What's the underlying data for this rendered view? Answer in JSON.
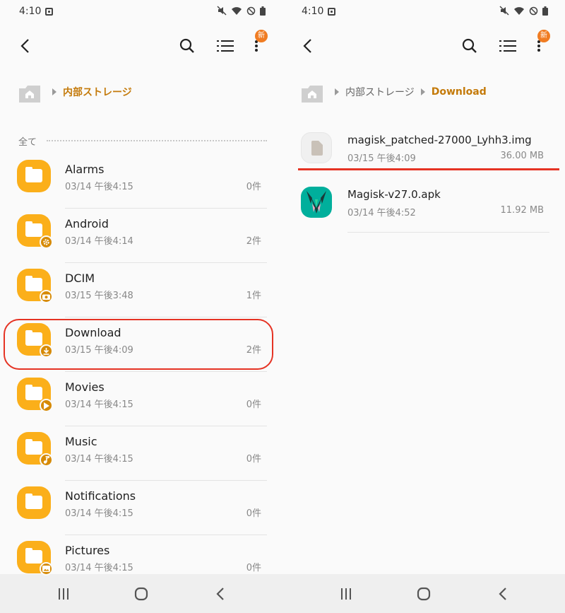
{
  "status": {
    "time": "4:10"
  },
  "left_screen": {
    "breadcrumb": [
      "内部ストレージ"
    ],
    "section_label": "全て",
    "folders": [
      {
        "name": "Alarms",
        "date": "03/14 午後4:15",
        "count": "0件",
        "badge": ""
      },
      {
        "name": "Android",
        "date": "03/14 午後4:14",
        "count": "2件",
        "badge": "gear-icon"
      },
      {
        "name": "DCIM",
        "date": "03/15 午後3:48",
        "count": "1件",
        "badge": "camera-icon"
      },
      {
        "name": "Download",
        "date": "03/15 午後4:09",
        "count": "2件",
        "badge": "download-icon"
      },
      {
        "name": "Movies",
        "date": "03/14 午後4:15",
        "count": "0件",
        "badge": "play-icon"
      },
      {
        "name": "Music",
        "date": "03/14 午後4:15",
        "count": "0件",
        "badge": "music-note-icon"
      },
      {
        "name": "Notifications",
        "date": "03/14 午後4:15",
        "count": "0件",
        "badge": ""
      },
      {
        "name": "Pictures",
        "date": "03/14 午後4:15",
        "count": "0件",
        "badge": "image-icon"
      }
    ]
  },
  "right_screen": {
    "breadcrumb": [
      "内部ストレージ",
      "Download"
    ],
    "files": [
      {
        "name": "magisk_patched-27000_Lyhh3.img",
        "date": "03/15 午後4:09",
        "size": "36.00 MB",
        "icon": "document-icon"
      },
      {
        "name": "Magisk-v27.0.apk",
        "date": "03/14 午後4:52",
        "size": "11.92 MB",
        "icon": "magisk-app-icon"
      }
    ]
  },
  "appbar": {
    "new_badge": "新"
  },
  "colors": {
    "accent": "#c47a0a",
    "folder": "#fbaf1a",
    "highlight": "#e53324",
    "badge": "#f07c22"
  }
}
